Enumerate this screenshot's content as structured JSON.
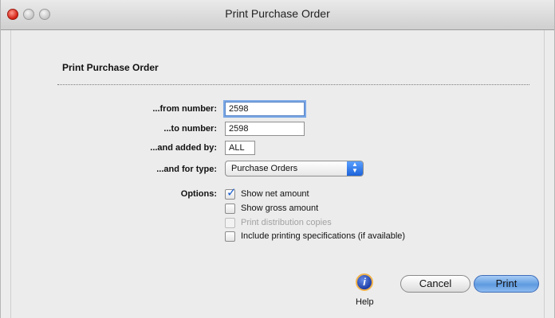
{
  "window": {
    "title": "Print Purchase Order"
  },
  "form": {
    "heading": "Print Purchase Order",
    "from_label": "...from number:",
    "from_value": "2598",
    "to_label": "...to number:",
    "to_value": "2598",
    "added_by_label": "...and added by:",
    "added_by_value": "ALL",
    "type_label": "...and for type:",
    "type_value": "Purchase Orders",
    "options_label": "Options:",
    "options": [
      {
        "label": "Show net amount",
        "checked": true,
        "enabled": true
      },
      {
        "label": "Show gross amount",
        "checked": false,
        "enabled": true
      },
      {
        "label": "Print distribution copies",
        "checked": false,
        "enabled": false
      },
      {
        "label": "Include printing specifications (if available)",
        "checked": false,
        "enabled": true
      }
    ]
  },
  "buttons": {
    "help_icon_glyph": "i",
    "help_label": "Help",
    "cancel_label": "Cancel",
    "print_label": "Print"
  },
  "icons": {
    "help": "info-icon",
    "popup": "updown-arrows-icon",
    "check": "checkmark-icon"
  },
  "colors": {
    "accent": "#2f6ed8",
    "help_ring": "#f0b24a"
  }
}
